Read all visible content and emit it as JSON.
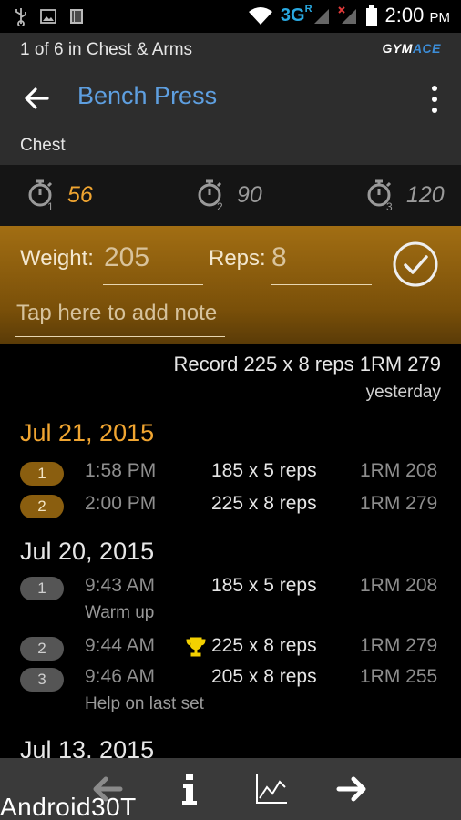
{
  "status": {
    "time": "2:00",
    "ampm": "PM",
    "network": "3G",
    "roaming": "R"
  },
  "header": {
    "breadcrumb": "1 of 6 in Chest & Arms",
    "logo": {
      "prefix": "GYM",
      "accent": "ACE"
    },
    "title": "Bench Press",
    "muscle": "Chest"
  },
  "timers": [
    {
      "value": "56",
      "index": "1"
    },
    {
      "value": "90",
      "index": "2"
    },
    {
      "value": "120",
      "index": "3"
    }
  ],
  "entry": {
    "weight_label": "Weight:",
    "weight_value": "205",
    "reps_label": "Reps:",
    "reps_value": "8",
    "note_placeholder": "Tap here to add note"
  },
  "record": {
    "text": "Record 225 x 8 reps 1RM 279",
    "when": "yesterday"
  },
  "history": [
    {
      "date": "Jul 21, 2015",
      "sets": [
        {
          "num": "1",
          "time": "1:58 PM",
          "work": "185 x 5 reps",
          "rm": "1RM 208"
        },
        {
          "num": "2",
          "time": "2:00 PM",
          "work": "225 x 8 reps",
          "rm": "1RM 279"
        }
      ]
    },
    {
      "date": "Jul 20, 2015",
      "sets": [
        {
          "num": "1",
          "time": "9:43 AM",
          "work": "185 x 5 reps",
          "rm": "1RM 208",
          "note": "Warm up"
        },
        {
          "num": "2",
          "time": "9:44 AM",
          "work": "225 x 8 reps",
          "rm": "1RM 279"
        },
        {
          "num": "3",
          "time": "9:46 AM",
          "work": "205 x 8 reps",
          "rm": "1RM 255",
          "note": "Help on last set"
        }
      ]
    },
    {
      "date": "Jul 13, 2015",
      "sets": []
    }
  ],
  "watermark": "Android30T",
  "colors": {
    "accent": "#f0a531",
    "title": "#5e9fe0",
    "entry_bg": "#8a5e0f"
  }
}
